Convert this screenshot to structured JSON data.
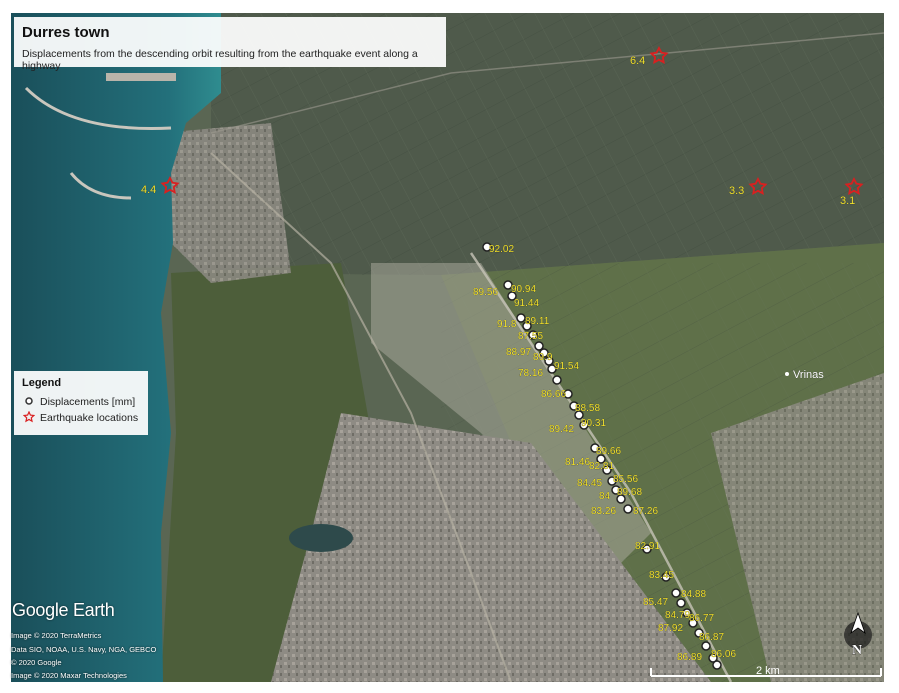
{
  "title": "Durres town",
  "subtitle": "Displacements from the descending orbit resulting from the earthquake event along a highway",
  "legend": {
    "title": "Legend",
    "displacement_label": "Displacements [mm]",
    "earthquake_label": "Earthquake locations"
  },
  "place_label": "Vrinas",
  "scale_label": "2 km",
  "north_label": "N",
  "brand": "Google Earth",
  "credits": [
    "Image © 2020 TerraMetrics",
    "Data SIO, NOAA, U.S. Navy, NGA, GEBCO",
    "© 2020 Google",
    "Image © 2020 Maxar Technologies"
  ],
  "earthquakes": [
    "4.4",
    "6.4",
    "3.3",
    "3.1"
  ],
  "displacement_labels": [
    "92.02",
    "89.56",
    "90.94",
    "91.44",
    "91.8",
    "89.11",
    "87.55",
    "88.97",
    "89.9",
    "91.54",
    "78.16",
    "86.66",
    "88.58",
    "90.31",
    "89.42",
    "89.66",
    "81.46",
    "82.81",
    "84.45",
    "85.56",
    "84",
    "89.68",
    "83.26",
    "87.26",
    "82.91",
    "83.45",
    "84.88",
    "85.47",
    "84.79",
    "86.77",
    "87.92",
    "86.87",
    "86.89",
    "86.06"
  ],
  "colors": {
    "sea": "#1c5f6b",
    "farmland_north": "#556451",
    "farmland_south": "#5e6e49",
    "urban": "#8d8a82",
    "label_yellow": "#f2e22e",
    "star_red": "#d92020"
  }
}
